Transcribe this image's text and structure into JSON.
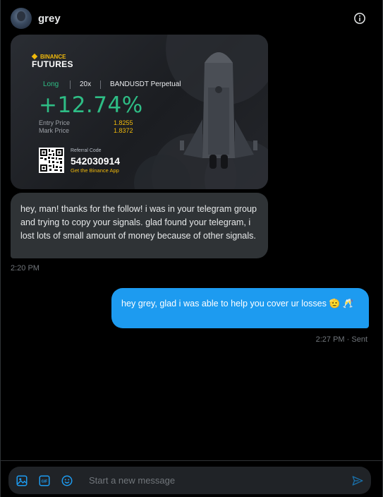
{
  "header": {
    "title": "grey",
    "info_icon": "info-icon"
  },
  "card": {
    "brand_top": "BINANCE",
    "brand_sub": "FUTURES",
    "side": "Long",
    "leverage": "20x",
    "pair": "BANDUSDT Perpetual",
    "pnl_percent": "+12.74%",
    "entry_label": "Entry Price",
    "entry_value": "1.8255",
    "mark_label": "Mark Price",
    "mark_value": "1.8372",
    "referral_label": "Referral Code",
    "referral_code": "542030914",
    "app_link": "Get the Binance App",
    "colors": {
      "profit": "#2ebd85",
      "brand": "#f0b90b"
    }
  },
  "messages": [
    {
      "direction": "incoming",
      "text": "hey, man! thanks for the follow! i was in your telegram group and trying to copy your signals. glad found your telegram, i lost lots of small amount of money because of other signals.",
      "time": "2:20 PM"
    },
    {
      "direction": "outgoing",
      "text": "hey grey, glad i was able to help you cover ur losses 🫡 🥂",
      "time": "2:27 PM · Sent"
    }
  ],
  "composer": {
    "placeholder": "Start a new message",
    "icons": [
      "image-icon",
      "gif-icon",
      "emoji-icon",
      "send-icon"
    ]
  },
  "colors": {
    "accent": "#1d9bf0",
    "bubble_in": "#2f3336",
    "bg": "#000000"
  }
}
